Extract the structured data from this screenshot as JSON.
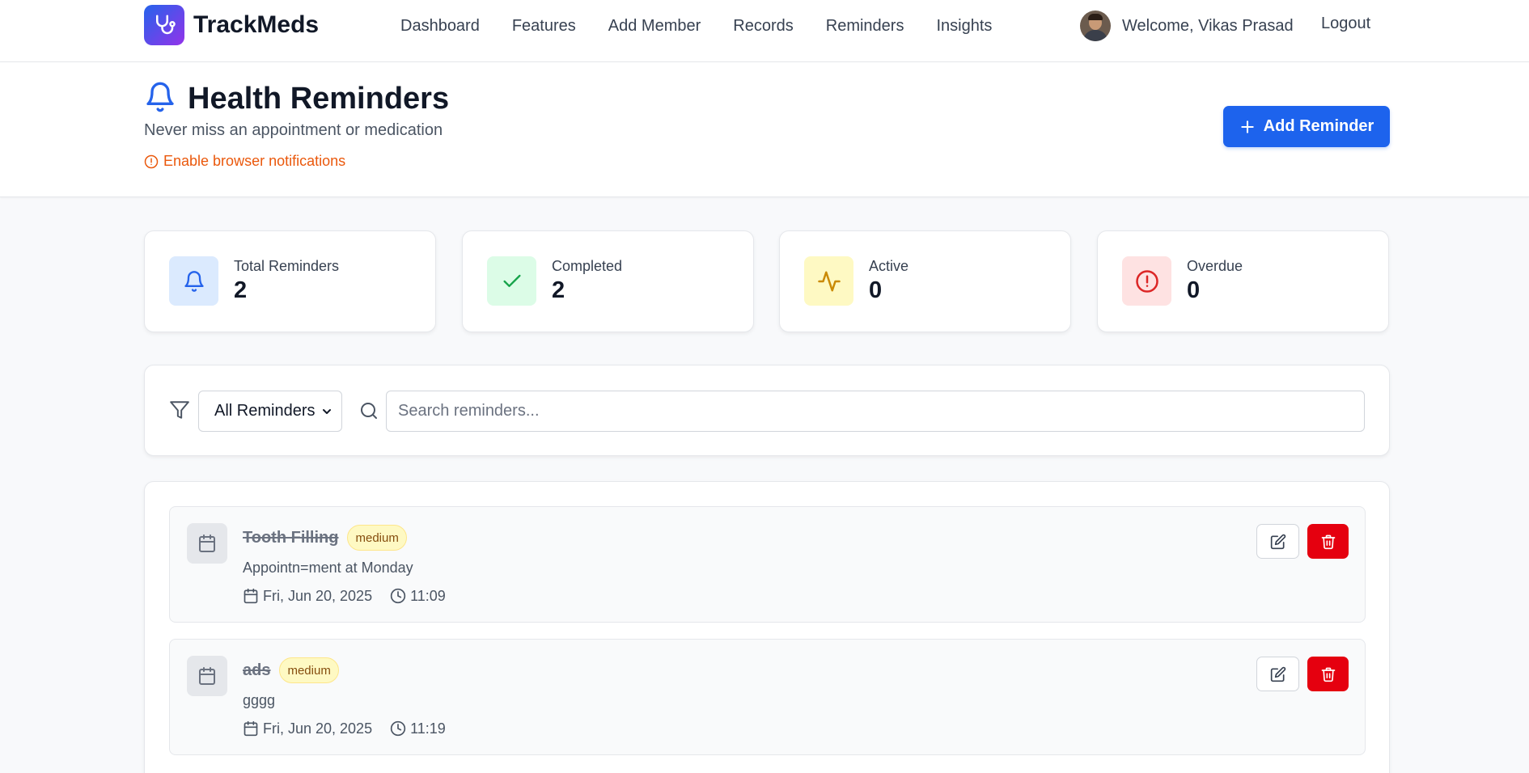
{
  "brand": {
    "name": "TrackMeds",
    "logo_icon": "stethoscope-icon"
  },
  "nav": {
    "links": [
      "Dashboard",
      "Features",
      "Add Member",
      "Records",
      "Reminders",
      "Insights"
    ],
    "welcome": "Welcome, Vikas Prasad",
    "logout": "Logout"
  },
  "header": {
    "title": "Health Reminders",
    "subtitle": "Never miss an appointment or medication",
    "notification_link": "Enable browser notifications",
    "add_button": "Add Reminder"
  },
  "stats": [
    {
      "label": "Total Reminders",
      "value": "2",
      "icon": "bell-icon",
      "color": "#2563eb",
      "bg": "#dbeafe"
    },
    {
      "label": "Completed",
      "value": "2",
      "icon": "check-icon",
      "color": "#16a34a",
      "bg": "#dcfce7"
    },
    {
      "label": "Active",
      "value": "0",
      "icon": "activity-icon",
      "color": "#ca8a04",
      "bg": "#fef9c3"
    },
    {
      "label": "Overdue",
      "value": "0",
      "icon": "alert-circle-icon",
      "color": "#dc2626",
      "bg": "#fee2e2"
    }
  ],
  "filter": {
    "selected": "All Reminders",
    "search_placeholder": "Search reminders..."
  },
  "reminders": [
    {
      "title": "Tooth Filling",
      "priority": "medium",
      "description": "Appointn=ment at Monday",
      "date": "Fri, Jun 20, 2025",
      "time": "11:09",
      "completed": true
    },
    {
      "title": "ads",
      "priority": "medium",
      "description": "gggg",
      "date": "Fri, Jun 20, 2025",
      "time": "11:19",
      "completed": true
    }
  ],
  "colors": {
    "primary": "#1d63ed",
    "danger": "#e5000f",
    "warning_text": "#ea580c"
  }
}
